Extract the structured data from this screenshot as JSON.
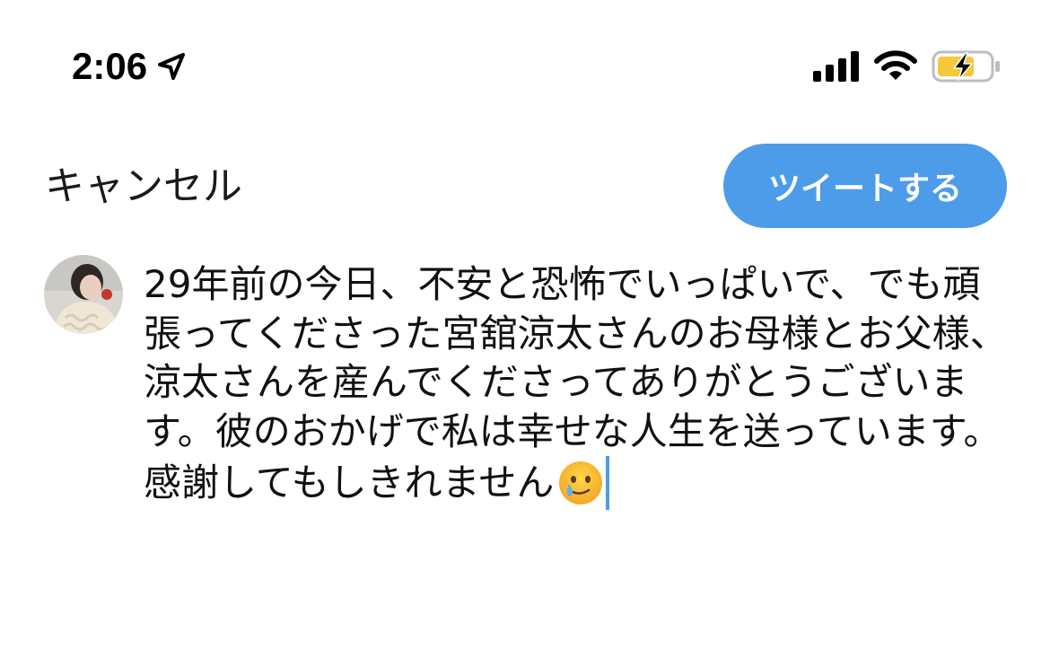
{
  "status_bar": {
    "time": "2:06",
    "location_icon": "location-arrow-icon",
    "signal_icon": "cellular-signal-icon",
    "wifi_icon": "wifi-icon",
    "battery_icon": "battery-charging-icon",
    "battery_color": "#f5c73b"
  },
  "nav": {
    "cancel_label": "キャンセル",
    "tweet_button_label": "ツイートする",
    "accent_color": "#4c9cea"
  },
  "compose": {
    "avatar_icon": "user-avatar",
    "text": "29年前の今日、不安と恐怖でいっぱいで、でも頑張ってくださった宮舘涼太さんのお母様とお父様、涼太さんを産んでくださってありがとうございます。彼のおかげで私は幸せな人生を送っています。感謝してもしきれません",
    "emoji_icon": "face-holding-back-tears-icon"
  }
}
